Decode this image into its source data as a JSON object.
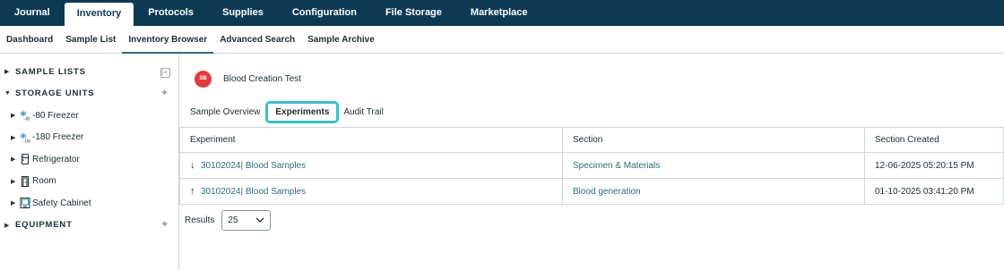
{
  "topnav": [
    "Journal",
    "Inventory",
    "Protocols",
    "Supplies",
    "Configuration",
    "File Storage",
    "Marketplace"
  ],
  "topnav_active": "Inventory",
  "subnav": [
    "Dashboard",
    "Sample List",
    "Inventory Browser",
    "Advanced Search",
    "Sample Archive"
  ],
  "subnav_active": "Inventory Browser",
  "sidebar": {
    "sample_lists": "SAMPLE LISTS",
    "storage_units": "STORAGE UNITS",
    "equipment": "EQUIPMENT",
    "items": [
      {
        "label": "-80 Freezer",
        "icon": "freezer-80-icon"
      },
      {
        "label": "-180 Freezer",
        "icon": "freezer-180-icon"
      },
      {
        "label": "Refrigerator",
        "icon": "refrigerator-icon"
      },
      {
        "label": "Room",
        "icon": "room-door-icon"
      },
      {
        "label": "Safety Cabinet",
        "icon": "safety-cabinet-icon"
      }
    ]
  },
  "record": {
    "initials": "SB",
    "title": "Blood Creation Test"
  },
  "record_tabs": [
    "Sample Overview",
    "Experiments",
    "Audit Trail"
  ],
  "record_tab_active": "Experiments",
  "table": {
    "headers": [
      "Experiment",
      "Section",
      "Section Created"
    ],
    "rows": [
      {
        "direction": "down",
        "experiment": "30102024| Blood Samples",
        "section": "Specimen & Materials",
        "created": "12-06-2025 05:20:15 PM"
      },
      {
        "direction": "up",
        "experiment": "30102024| Blood Samples",
        "section": "Blood generation",
        "created": "01-10-2025 03:41:20 PM"
      }
    ]
  },
  "results": {
    "label": "Results",
    "value": "25"
  },
  "colors": {
    "nav_bg": "#0d3a52",
    "accent": "#39c2c9",
    "link": "#2e6f73",
    "avatar": "#e23b3b"
  }
}
